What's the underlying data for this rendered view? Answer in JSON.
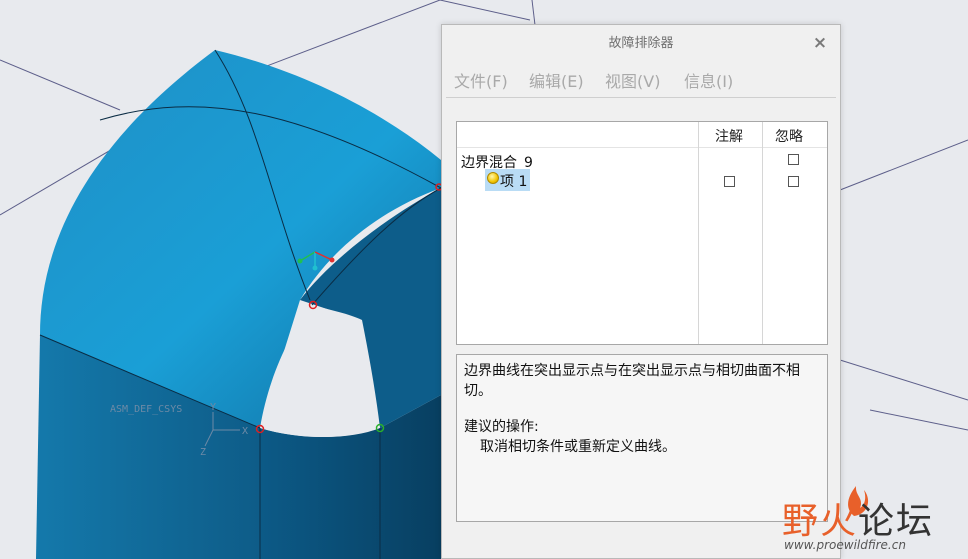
{
  "viewport": {
    "csys_label": "ASM_DEF_CSYS",
    "axis_x": "X",
    "axis_y": "Y",
    "axis_z": "Z",
    "colors": {
      "surface": "#1b86bd",
      "surface_dark": "#0c4f77",
      "background": "#e8eaee"
    }
  },
  "dialog": {
    "title": "故障排除器",
    "close_glyph": "×",
    "menu": [
      "文件(F)",
      "编辑(E)",
      "视图(V)",
      "信息(I)"
    ],
    "tree": {
      "col_note": "注解",
      "col_ignore": "忽略",
      "rows": [
        {
          "label": "边界混合_9",
          "note_checkbox": false,
          "ignore_checkbox": true
        },
        {
          "label": "项 1",
          "note_checkbox": true,
          "ignore_checkbox": true,
          "icon": "warning-bulb-icon"
        }
      ]
    },
    "message": {
      "line1": "边界曲线在突出显示点与在突出显示点与相切曲面不相",
      "line2": "切。",
      "suggest_title": "建议的操作:",
      "suggest_body": "取消相切条件或重新定义曲线。"
    }
  },
  "watermark": {
    "text_cn_1": "野火",
    "text_cn_2": "论坛",
    "url": "www.proewildfire.cn"
  }
}
